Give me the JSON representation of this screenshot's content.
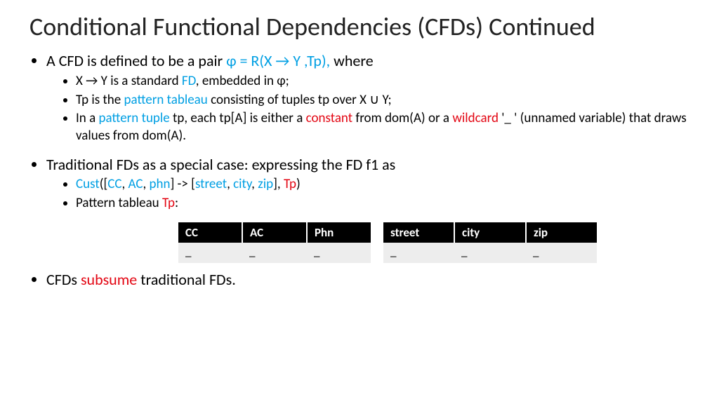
{
  "title": "Conditional Functional Dependencies (CFDs) Continued",
  "b1": {
    "prefix": "A CFD is defined to be a pair ",
    "formula": "φ = R(X → Y ,Tp),",
    "suffix": " where",
    "sub1_a": "X → Y is a standard ",
    "sub1_b": "FD",
    "sub1_c": ", embedded in φ;",
    "sub2_a": "Tp is the ",
    "sub2_b": "pattern tableau",
    "sub2_c": " consisting of tuples tp over X ∪ Y;",
    "sub3_a": "In a ",
    "sub3_b": "pattern tuple",
    "sub3_c": " tp, each tp[A] is either a ",
    "sub3_d": "constant",
    "sub3_e": " from dom(A) or a ",
    "sub3_f": "wildcard",
    "sub3_g": "   '_ ' (unnamed variable) that draws values from dom(A)."
  },
  "b2": {
    "line": "Traditional FDs as a special case: expressing the FD f1 as",
    "cust": "Cust",
    "cc": "CC",
    "ac": "AC",
    "phn": "phn",
    "street": "street",
    "city": "city",
    "zip": "zip",
    "tp": "Tp",
    "tableau_label_a": "Pattern tableau ",
    "tableau_label_b": "Tp",
    "tableau_label_c": ":"
  },
  "b3": {
    "a": "CFDs ",
    "b": "subsume",
    "c": " traditional FDs."
  },
  "table1": {
    "h1": "CC",
    "h2": "AC",
    "h3": "Phn",
    "r1c1": "_",
    "r1c2": "_",
    "r1c3": "_"
  },
  "table2": {
    "h1": "street",
    "h2": "city",
    "h3": "zip",
    "r1c1": "_",
    "r1c2": "_",
    "r1c3": "_"
  },
  "punct": {
    "lbr": "([",
    "comma": ", ",
    "rbr": "]",
    "arrow": "    -> [",
    "rbr2": "], ",
    "rpar": ")"
  }
}
